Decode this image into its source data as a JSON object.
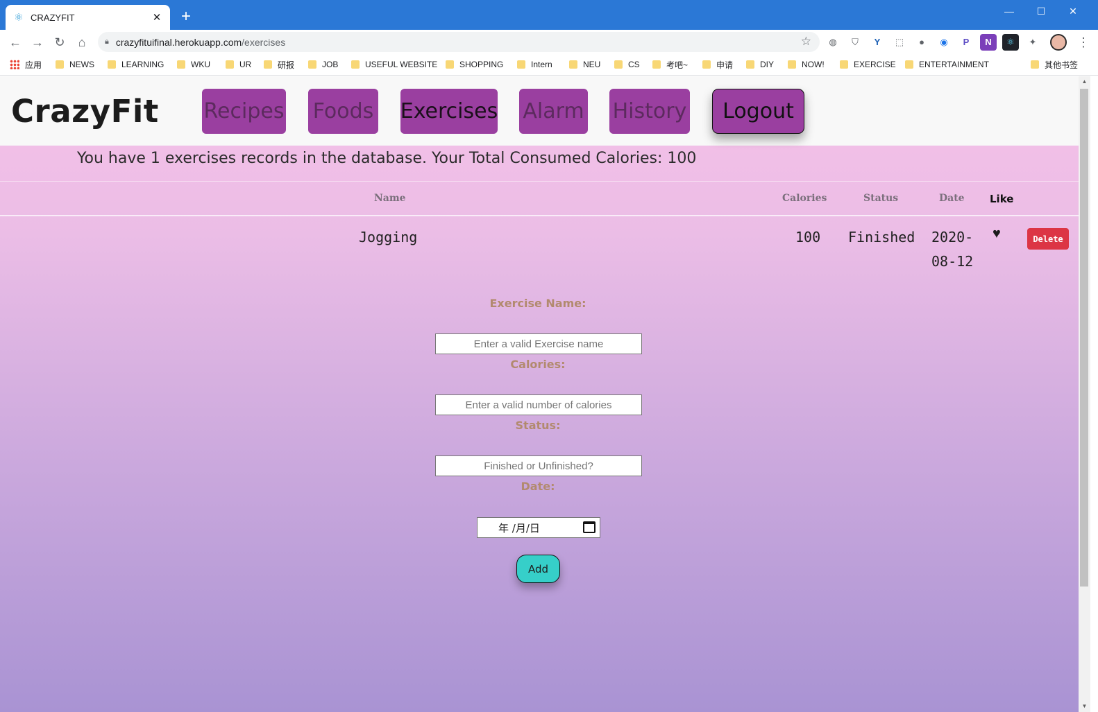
{
  "browser": {
    "tab_title": "CRAZYFIT",
    "tab_favicon": "react-icon",
    "url_host": "crazyfituifinal.herokuapp.com",
    "url_path": "/exercises",
    "bookmarks": [
      "应用",
      "NEWS",
      "LEARNING",
      "WKU",
      "UR",
      "研报",
      "JOB",
      "USEFUL WEBSITE",
      "SHOPPING",
      "Intern",
      "NEU",
      "CS",
      "考吧~",
      "申请",
      "DIY",
      "NOW!",
      "EXERCISE",
      "ENTERTAINMENT",
      "其他书签"
    ]
  },
  "app": {
    "brand": "CrazyFit",
    "nav": {
      "recipes": "Recipes",
      "foods": "Foods",
      "exercises": "Exercises",
      "alarm": "Alarm",
      "history": "History",
      "logout": "Logout"
    },
    "summary": "You have 1 exercises records in the database. Your Total Consumed Calories: 100",
    "table": {
      "headers": {
        "name": "Name",
        "calories": "Calories",
        "status": "Status",
        "date": "Date",
        "like": "Like"
      },
      "rows": [
        {
          "name": "Jogging",
          "calories": "100",
          "status": "Finished",
          "date_line1": "2020-",
          "date_line2": "08-12",
          "liked": true,
          "delete_label": "Delete"
        }
      ]
    },
    "form": {
      "name_label": "Exercise Name:",
      "name_placeholder": "Enter a valid Exercise name",
      "calories_label": "Calories:",
      "calories_placeholder": "Enter a valid number of calories",
      "status_label": "Status:",
      "status_placeholder": "Finished or Unfinished?",
      "date_label": "Date:",
      "date_placeholder": "年 /月/日",
      "add_label": "Add"
    }
  },
  "colors": {
    "tabbar": "#2b78d6",
    "nav_button": "#9a3fa0",
    "delete": "#dc3545",
    "add": "#36cfc9",
    "form_label": "#b28a6e"
  }
}
